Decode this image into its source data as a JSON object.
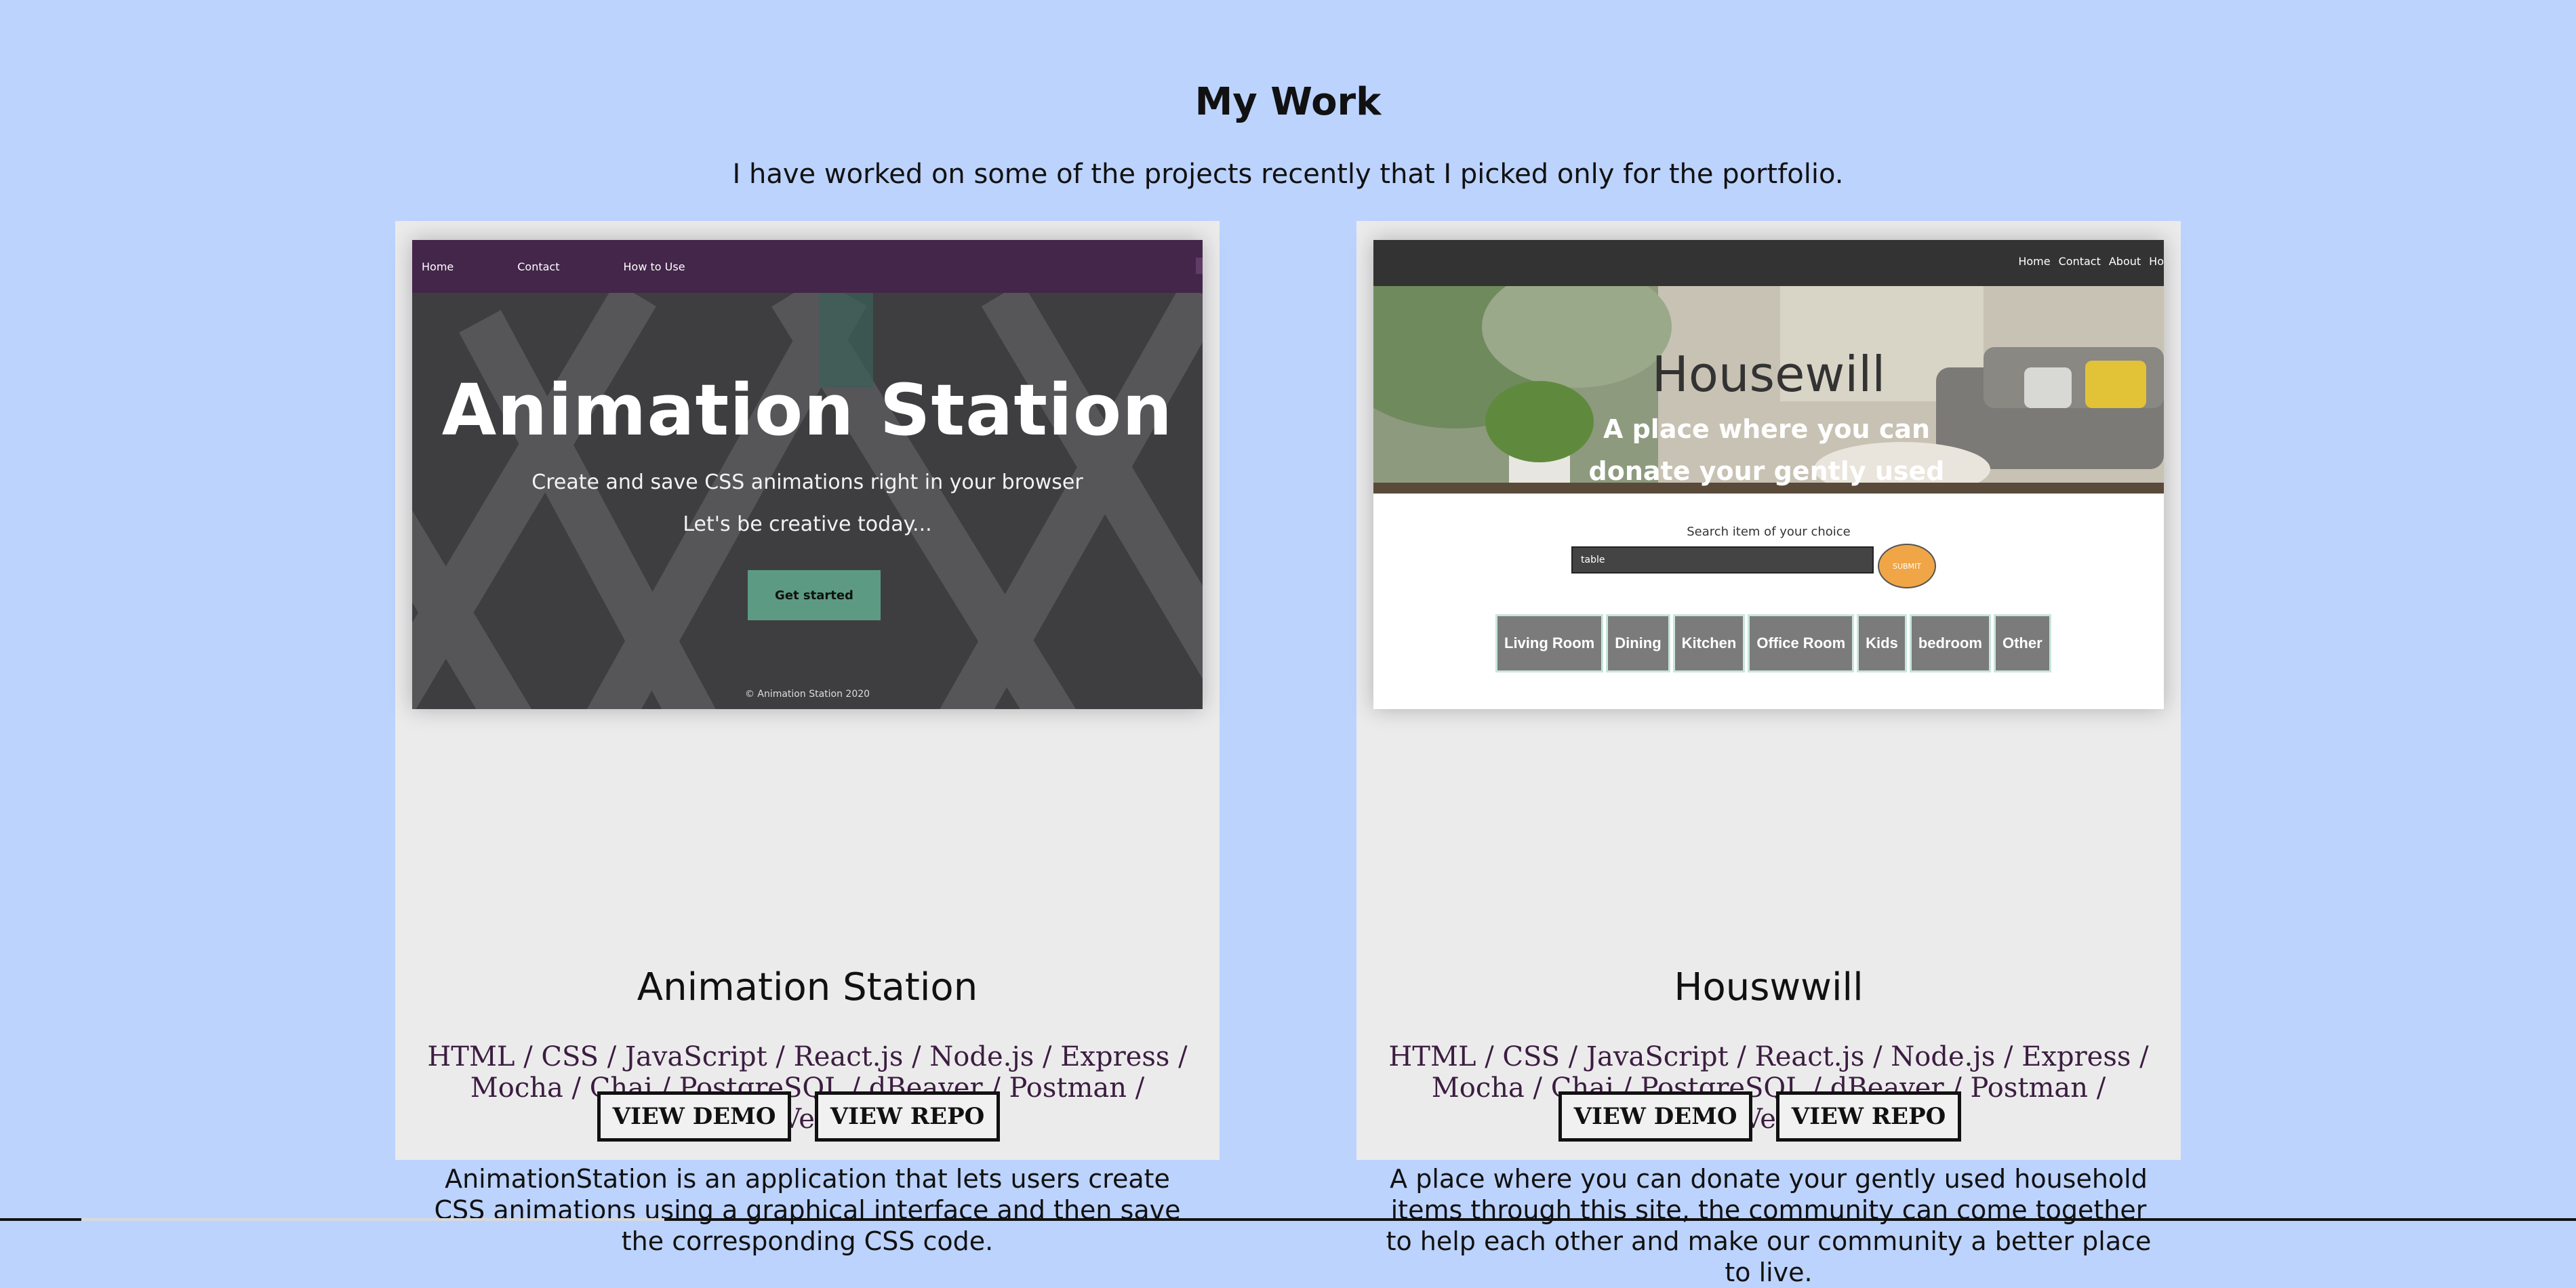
{
  "header": {
    "title": "My Work",
    "subtitle": "I have worked on some of the projects recently that I picked only for the portfolio."
  },
  "projects": [
    {
      "title": "Animation Station",
      "tech": "HTML / CSS / JavaScript / React.js / Node.js / Express / Mocha / Chai / PostgreSQL / dBeaver / Postman / Heroku / Vercel Vercel",
      "description": "AnimationStation is an application that lets users create CSS animations using a graphical interface and then save the corresponding CSS code.",
      "demo_label": "VIEW DEMO",
      "repo_label": "VIEW REPO",
      "preview": {
        "nav": [
          "Home",
          "Contact",
          "How to Use"
        ],
        "title": "Animation Station",
        "line1": "Create and save CSS animations right in your browser",
        "line2": "Let's be creative today...",
        "cta": "Get started",
        "footer": "© Animation Station 2020"
      }
    },
    {
      "title": "Houswwill",
      "tech": "HTML / CSS / JavaScript / React.js / Node.js / Express / Mocha / Chai / PostgreSQL / dBeaver / Postman / Heroku / Vercel Vercel",
      "description": "A place where you can donate your gently used household items through this site, the community can come together to help each other and make our community a better place to live.",
      "demo_label": "VIEW DEMO",
      "repo_label": "VIEW REPO",
      "preview": {
        "nav": [
          "Home",
          "Contact",
          "About",
          "Ho"
        ],
        "title": "Housewill",
        "tagline": "A place where you can donate your gently used household items",
        "search_label": "Search item of your choice",
        "search_value": "table",
        "submit": "SUBMIT",
        "categories": [
          "Living Room",
          "Dining",
          "Kitchen",
          "Office Room",
          "Kids",
          "bedroom",
          "Other"
        ]
      }
    }
  ],
  "colors": {
    "page_bg": "#bcd3fe",
    "card_bg": "#ecebec",
    "tech_text": "#3b1d40",
    "as_nav": "#44264a",
    "as_cta": "#5c9a83",
    "hw_submit": "#f0a646"
  }
}
